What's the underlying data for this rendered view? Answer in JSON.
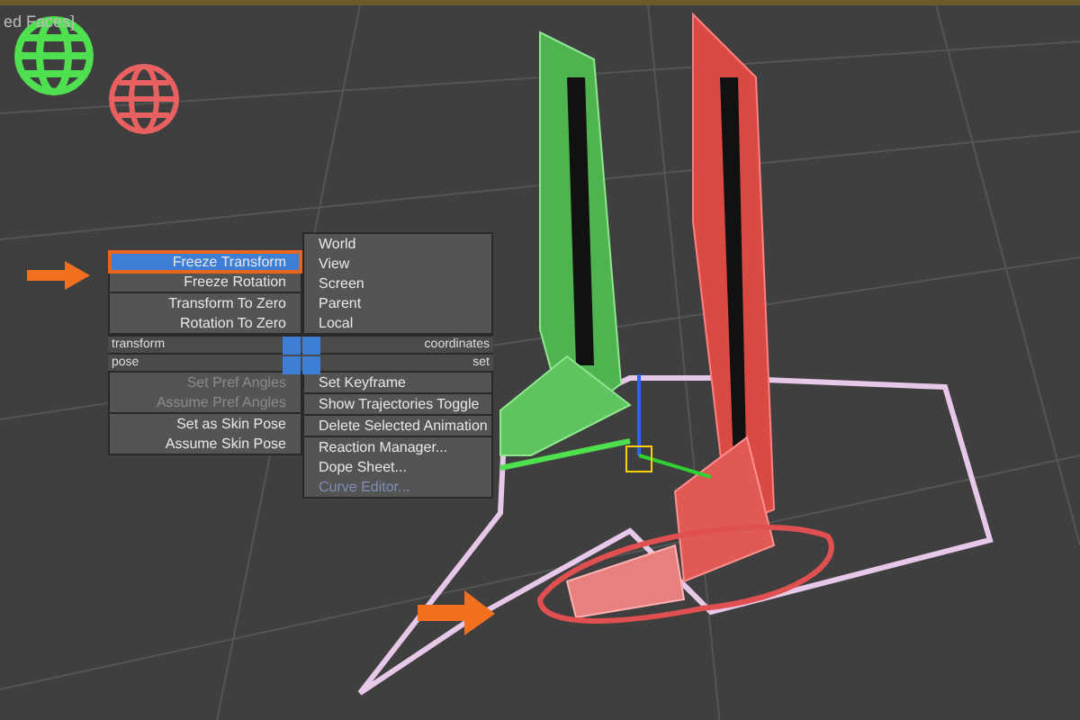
{
  "viewport": {
    "label": "ed Faces]"
  },
  "quad_menu": {
    "top_left": {
      "items": [
        {
          "label": "Freeze Transform",
          "selected": true,
          "disabled": false,
          "separator_above": false
        },
        {
          "label": "Freeze Rotation",
          "selected": false,
          "disabled": false,
          "separator_above": false
        },
        {
          "label": "Transform To Zero",
          "selected": false,
          "disabled": false,
          "separator_above": true
        },
        {
          "label": "Rotation To Zero",
          "selected": false,
          "disabled": false,
          "separator_above": false
        }
      ]
    },
    "top_right": {
      "items": [
        {
          "label": "World",
          "selected": false,
          "disabled": false,
          "separator_above": false
        },
        {
          "label": "View",
          "selected": false,
          "disabled": false,
          "separator_above": false
        },
        {
          "label": "Screen",
          "selected": false,
          "disabled": false,
          "separator_above": false
        },
        {
          "label": "Parent",
          "selected": false,
          "disabled": false,
          "separator_above": false
        },
        {
          "label": "Local",
          "selected": false,
          "disabled": false,
          "separator_above": false
        }
      ]
    },
    "headers": [
      {
        "left": "transform",
        "right": "coordinates"
      },
      {
        "left": "pose",
        "right": "set"
      }
    ],
    "bottom_left": {
      "items": [
        {
          "label": "Set Pref Angles",
          "selected": false,
          "disabled": true,
          "separator_above": false
        },
        {
          "label": "Assume Pref Angles",
          "selected": false,
          "disabled": true,
          "separator_above": false
        },
        {
          "label": "Set as Skin Pose",
          "selected": false,
          "disabled": false,
          "separator_above": true
        },
        {
          "label": "Assume Skin Pose",
          "selected": false,
          "disabled": false,
          "separator_above": false
        }
      ]
    },
    "bottom_right": {
      "items": [
        {
          "label": "Set Keyframe",
          "selected": false,
          "disabled": false,
          "separator_above": false
        },
        {
          "label": "Show Trajectories Toggle",
          "selected": false,
          "disabled": false,
          "separator_above": true
        },
        {
          "label": "Delete Selected Animation",
          "selected": false,
          "disabled": false,
          "separator_above": true
        },
        {
          "label": "Reaction Manager...",
          "selected": false,
          "disabled": false,
          "separator_above": true
        },
        {
          "label": "Dope Sheet...",
          "selected": false,
          "disabled": false,
          "separator_above": false
        },
        {
          "label": "Curve Editor...",
          "selected": false,
          "disabled": true,
          "separator_above": false
        }
      ]
    }
  }
}
